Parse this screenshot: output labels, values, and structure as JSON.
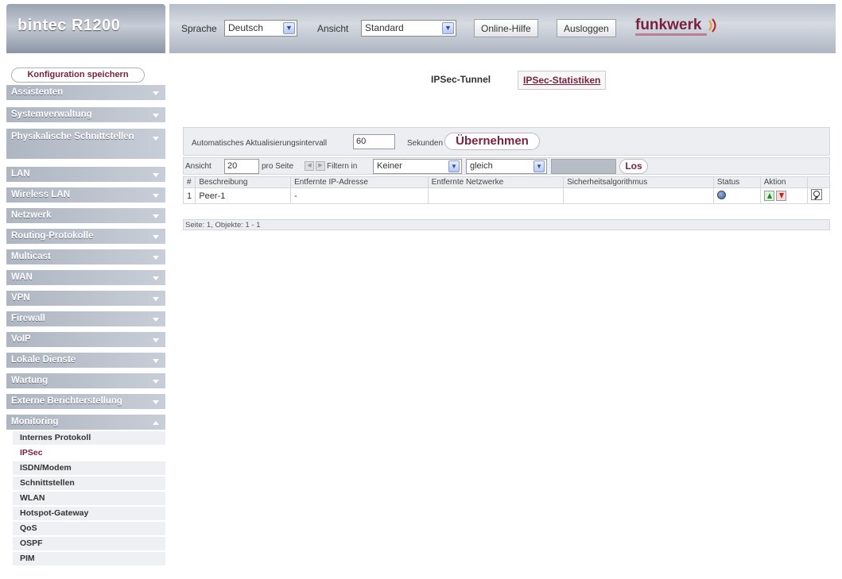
{
  "header": {
    "product": "bintec R1200",
    "language_label": "Sprache",
    "language_value": "Deutsch",
    "view_label": "Ansicht",
    "view_value": "Standard",
    "online_help": "Online-Hilfe",
    "logout": "Ausloggen",
    "brand": "funkwerk"
  },
  "sidebar": {
    "save_config": "Konfiguration speichern",
    "items": [
      {
        "label": "Assistenten"
      },
      {
        "label": "Systemverwaltung"
      },
      {
        "label": "Physikalische Schnittstellen"
      },
      {
        "label": "LAN"
      },
      {
        "label": "Wireless LAN"
      },
      {
        "label": "Netzwerk"
      },
      {
        "label": "Routing-Protokolle"
      },
      {
        "label": "Multicast"
      },
      {
        "label": "WAN"
      },
      {
        "label": "VPN"
      },
      {
        "label": "Firewall"
      },
      {
        "label": "VoIP"
      },
      {
        "label": "Lokale Dienste"
      },
      {
        "label": "Wartung"
      },
      {
        "label": "Externe Berichterstellung"
      },
      {
        "label": "Monitoring"
      }
    ],
    "submenu": [
      {
        "label": "Internes Protokoll"
      },
      {
        "label": "IPSec"
      },
      {
        "label": "ISDN/Modem"
      },
      {
        "label": "Schnittstellen"
      },
      {
        "label": "WLAN"
      },
      {
        "label": "Hotspot-Gateway"
      },
      {
        "label": "QoS"
      },
      {
        "label": "OSPF"
      },
      {
        "label": "PIM"
      }
    ]
  },
  "tabs": {
    "active": "IPSec-Tunnel",
    "other": "IPSec-Statistiken"
  },
  "refresh": {
    "label": "Automatisches Aktualisierungsintervall",
    "value": "60",
    "unit": "Sekunden",
    "apply": "Übernehmen"
  },
  "filter": {
    "view_label": "Ansicht",
    "per_page_value": "20",
    "per_page_label": "pro Seite",
    "filter_label": "Filtern in",
    "field_value": "Keiner",
    "operator_value": "gleich",
    "go": "Los"
  },
  "table": {
    "columns": [
      "#",
      "Beschreibung",
      "Entfernte IP-Adresse",
      "Entfernte Netzwerke",
      "Sicherheitsalgorithmus",
      "Status",
      "Aktion",
      ""
    ],
    "rows": [
      {
        "num": "1",
        "description": "Peer-1",
        "remote_ip": "-",
        "remote_networks": "",
        "security": "",
        "status_icon": "globe-icon",
        "actions": [
          "move-up-icon",
          "move-down-icon"
        ],
        "edit": "edit-icon"
      }
    ],
    "footer": "Seite: 1, Objekte: 1 - 1"
  },
  "colors": {
    "accent": "#7a2140",
    "nav_bg": "#aeb6c2",
    "status_blue": "#3b5a96"
  }
}
